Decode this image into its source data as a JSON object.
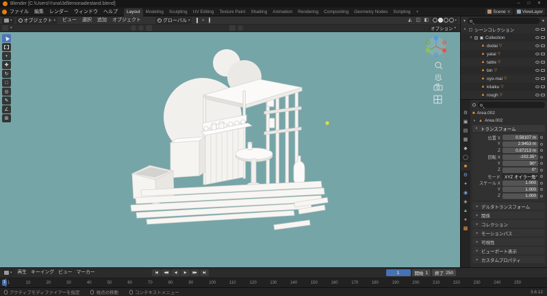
{
  "colors": {
    "accent_blue": "#4772b3",
    "accent_orange": "#e87d0d",
    "viewport_bg": "#76a5a8",
    "model_white": "#f5f3f0",
    "light_dot": "#d9e23a"
  },
  "icons": {
    "dropdown": "▾",
    "disclosure_open": "▾",
    "disclosure_closed": "▸",
    "check": "✓",
    "filter": "▼"
  },
  "window": {
    "title": "Blender [C:\\Users\\Yuna\\3d\\lemonadestand.blend]",
    "controls": {
      "minimize": "─",
      "maximize": "□",
      "close": "✕"
    }
  },
  "topbar": {
    "menus": [
      "ファイル",
      "編集",
      "レンダー",
      "ウィンドウ",
      "ヘルプ"
    ],
    "tabs": [
      {
        "label": "Layout",
        "active": true
      },
      {
        "label": "Modeling"
      },
      {
        "label": "Sculpting"
      },
      {
        "label": "UV Editing"
      },
      {
        "label": "Texture Paint"
      },
      {
        "label": "Shading"
      },
      {
        "label": "Animation"
      },
      {
        "label": "Rendering"
      },
      {
        "label": "Compositing"
      },
      {
        "label": "Geometry Nodes"
      },
      {
        "label": "Scripting"
      },
      {
        "label": "+"
      }
    ],
    "scene": {
      "label": "Scene",
      "close": "✕"
    },
    "viewlayer": {
      "label": "ViewLayer"
    }
  },
  "viewport_header": {
    "mode": "オブジェクト",
    "menus": [
      "ビュー",
      "選択",
      "追加",
      "オブジェクト"
    ],
    "orientation": "グローバル"
  },
  "tool_header": {
    "options_label": "オプション"
  },
  "toolbar": {
    "tools": [
      {
        "name": "tweak-select",
        "active": true
      },
      {
        "name": "select-box"
      },
      {
        "name": "cursor-3d",
        "glyph": "+"
      },
      {
        "name": "move",
        "glyph": "✚"
      },
      {
        "name": "rotate",
        "glyph": "↻"
      },
      {
        "name": "scale",
        "glyph": "□"
      },
      {
        "name": "transform",
        "glyph": "◎"
      },
      {
        "name": "annotate",
        "glyph": "✎"
      },
      {
        "name": "measure",
        "glyph": "∠"
      },
      {
        "name": "add-cube",
        "glyph": "⊞"
      }
    ]
  },
  "outliner": {
    "search_placeholder": "",
    "rows": [
      {
        "name": "シーンコレクション",
        "icon": "scene-collection",
        "level": 0,
        "disclosure": "▾"
      },
      {
        "name": "Collection",
        "icon": "collection",
        "level": 1,
        "disclosure": "▾",
        "checkbox": true
      },
      {
        "name": "dodai",
        "icon": "mesh",
        "level": 2
      },
      {
        "name": "yatai",
        "icon": "mesh",
        "level": 2
      },
      {
        "name": "table",
        "icon": "mesh",
        "level": 2
      },
      {
        "name": "bin",
        "icon": "mesh",
        "level": 2
      },
      {
        "name": "oyo-mai",
        "icon": "mesh",
        "level": 2
      },
      {
        "name": "kitaiku",
        "icon": "mesh",
        "level": 2
      },
      {
        "name": "rough",
        "icon": "mesh",
        "level": 2
      }
    ]
  },
  "properties": {
    "search_placeholder": "",
    "object_name": "Area.002",
    "transform": {
      "title": "トランスフォーム",
      "rows": [
        {
          "label": "位置 X",
          "value": "0.58107 m"
        },
        {
          "label": "Y",
          "value": "2.9453 m"
        },
        {
          "label": "Z",
          "value": "0.87213 m"
        },
        {
          "label": "回転 X",
          "value": "-102.35°"
        },
        {
          "label": "Y",
          "value": "90°"
        },
        {
          "label": "Z",
          "value": "0°"
        },
        {
          "label": "モード",
          "value": "XYZ オイラー角",
          "kind": "dropdown"
        },
        {
          "label": "スケール X",
          "value": "1.000"
        },
        {
          "label": "Y",
          "value": "1.000"
        },
        {
          "label": "Z",
          "value": "1.000"
        }
      ]
    },
    "sections": [
      "デルタトランスフォーム",
      "関係",
      "コレクション",
      "モーションパス",
      "可視性",
      "ビューポート表示",
      "カスタムプロパティ"
    ],
    "tabs": [
      {
        "name": "tool",
        "glyph": "⚙",
        "color": "#b0b0b0"
      },
      {
        "name": "render",
        "glyph": "▣",
        "color": "#b0b0b0"
      },
      {
        "name": "output",
        "glyph": "▤",
        "color": "#b0b0b0"
      },
      {
        "name": "view-layer",
        "glyph": "▦",
        "color": "#b0b0b0"
      },
      {
        "name": "scene",
        "glyph": "◆",
        "color": "#b0b0b0"
      },
      {
        "name": "world",
        "glyph": "◯",
        "color": "#8fb8d8"
      },
      {
        "name": "object",
        "glyph": "■",
        "color": "#e8953c",
        "active": true
      },
      {
        "name": "modifiers",
        "glyph": "⚙",
        "color": "#7aa2d8"
      },
      {
        "name": "particles",
        "glyph": "✦",
        "color": "#7aa2d8"
      },
      {
        "name": "physics",
        "glyph": "◉",
        "color": "#7aa2d8"
      },
      {
        "name": "constraints",
        "glyph": "◈",
        "color": "#b0b0b0"
      },
      {
        "name": "object-data",
        "glyph": "▲",
        "color": "#6fba6f"
      },
      {
        "name": "material",
        "glyph": "●",
        "color": "#d87a7a"
      },
      {
        "name": "texture",
        "glyph": "▩",
        "color": "#e8953c"
      }
    ]
  },
  "timeline": {
    "menus": [
      "再生",
      "キーイング",
      "ビュー",
      "マーカー"
    ],
    "playback": [
      "|◀",
      "◀◀",
      "◀",
      "▶",
      "▶▶",
      "▶|"
    ],
    "current_frame": "1",
    "start_label": "開始",
    "start_value": "1",
    "end_label": "終了",
    "end_value": "250",
    "ticks": [
      1,
      10,
      20,
      30,
      40,
      50,
      60,
      70,
      80,
      90,
      100,
      110,
      120,
      130,
      140,
      150,
      160,
      170,
      180,
      190,
      200,
      210,
      220,
      230,
      240,
      250
    ]
  },
  "statusbar": {
    "hints": [
      "アクティブモディファイアーを指定",
      "視点の移動",
      "コンテキストメニュー"
    ],
    "version": "3.6.12"
  }
}
